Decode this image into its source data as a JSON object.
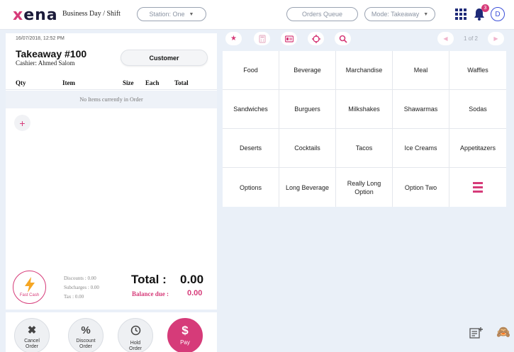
{
  "header": {
    "logo": "xena",
    "business_day": "Business Day / Shift",
    "station": "Station: One",
    "orders_queue": "Orders Queue",
    "mode": "Mode: Takeaway",
    "notifications_count": "3",
    "user_initial": "D"
  },
  "order": {
    "datetime": "16/07/2018, 12:52 PM",
    "title": "Takeaway #100",
    "cashier": "Cashier: Ahmed Salom",
    "customer_button": "Customer",
    "columns": [
      "Qty",
      "Item",
      "Size",
      "Each",
      "Total"
    ],
    "empty_message": "No Items currently in Order",
    "add_symbol": "+"
  },
  "summary": {
    "fast_cash": "Fast Cash",
    "discounts": "Discounts : 0.00",
    "subcharges": "Subcharges : 0.00",
    "tax": "Tax : 0.00",
    "total_label": "Total :",
    "total_value": "0.00",
    "balance_label": "Balance due :",
    "balance_value": "0.00"
  },
  "actions": {
    "cancel": "Cancel Order",
    "discount": "Discount Order",
    "hold": "Hold Order",
    "pay": "Pay",
    "pay_symbol": "$",
    "discount_symbol": "%",
    "cancel_symbol": "✖"
  },
  "pager": {
    "text": "1 of 2",
    "prev": "◀",
    "next": "▶"
  },
  "toolbar": {
    "icons": [
      "star-icon",
      "calculator-icon",
      "id-card-icon",
      "crosshair-icon",
      "search-icon"
    ]
  },
  "categories": [
    "Food",
    "Beverage",
    "Marchandise",
    "Meal",
    "Waffles",
    "Sandwiches",
    "Burguers",
    "Milkshakes",
    "Shawarmas",
    "Sodas",
    "Deserts",
    "Cocktails",
    "Tacos",
    "Ice Creams",
    "Appetitazers",
    "Options",
    "Long Beverage",
    "Really Long Option",
    "Option Two"
  ],
  "colors": {
    "accent": "#d63b79",
    "navy": "#1e2a78",
    "background": "#eaf0f8"
  }
}
